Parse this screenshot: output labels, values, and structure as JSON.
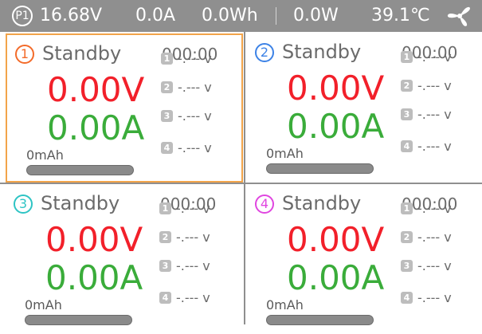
{
  "status": {
    "profile": "P1",
    "voltage": "16.68V",
    "current": "0.0A",
    "energy": "0.0Wh",
    "power": "0.0W",
    "temperature": "39.1℃",
    "icons": [
      "fan-icon"
    ],
    "colors": {
      "bar_bg": "#8f8f8f",
      "text": "#ffffff"
    }
  },
  "colors": {
    "voltage": "#f2202a",
    "current": "#3aac3a",
    "active_border": "#f2a44a"
  },
  "channels": [
    {
      "number": "1",
      "color": "#f36b2a",
      "state": "Standby",
      "timer": "000:00",
      "voltage": "0.00V",
      "current": "0.00A",
      "capacity": "0mAh",
      "cells": [
        {
          "index": "1",
          "value": "-.--- v"
        },
        {
          "index": "2",
          "value": "-.--- v"
        },
        {
          "index": "3",
          "value": "-.--- v"
        },
        {
          "index": "4",
          "value": "-.--- v"
        }
      ]
    },
    {
      "number": "2",
      "color": "#3c82e6",
      "state": "Standby",
      "timer": "000:00",
      "voltage": "0.00V",
      "current": "0.00A",
      "capacity": "0mAh",
      "cells": [
        {
          "index": "1",
          "value": "-.--- v"
        },
        {
          "index": "2",
          "value": "-.--- v"
        },
        {
          "index": "3",
          "value": "-.--- v"
        },
        {
          "index": "4",
          "value": "-.--- v"
        }
      ]
    },
    {
      "number": "3",
      "color": "#2ec4c4",
      "state": "Standby",
      "timer": "000:00",
      "voltage": "0.00V",
      "current": "0.00A",
      "capacity": "0mAh",
      "cells": [
        {
          "index": "1",
          "value": "-.--- v"
        },
        {
          "index": "2",
          "value": "-.--- v"
        },
        {
          "index": "3",
          "value": "-.--- v"
        },
        {
          "index": "4",
          "value": "-.--- v"
        }
      ]
    },
    {
      "number": "4",
      "color": "#e046e0",
      "state": "Standby",
      "timer": "000:00",
      "voltage": "0.00V",
      "current": "0.00A",
      "capacity": "0mAh",
      "cells": [
        {
          "index": "1",
          "value": "-.--- v"
        },
        {
          "index": "2",
          "value": "-.--- v"
        },
        {
          "index": "3",
          "value": "-.--- v"
        },
        {
          "index": "4",
          "value": "-.--- v"
        }
      ]
    }
  ]
}
